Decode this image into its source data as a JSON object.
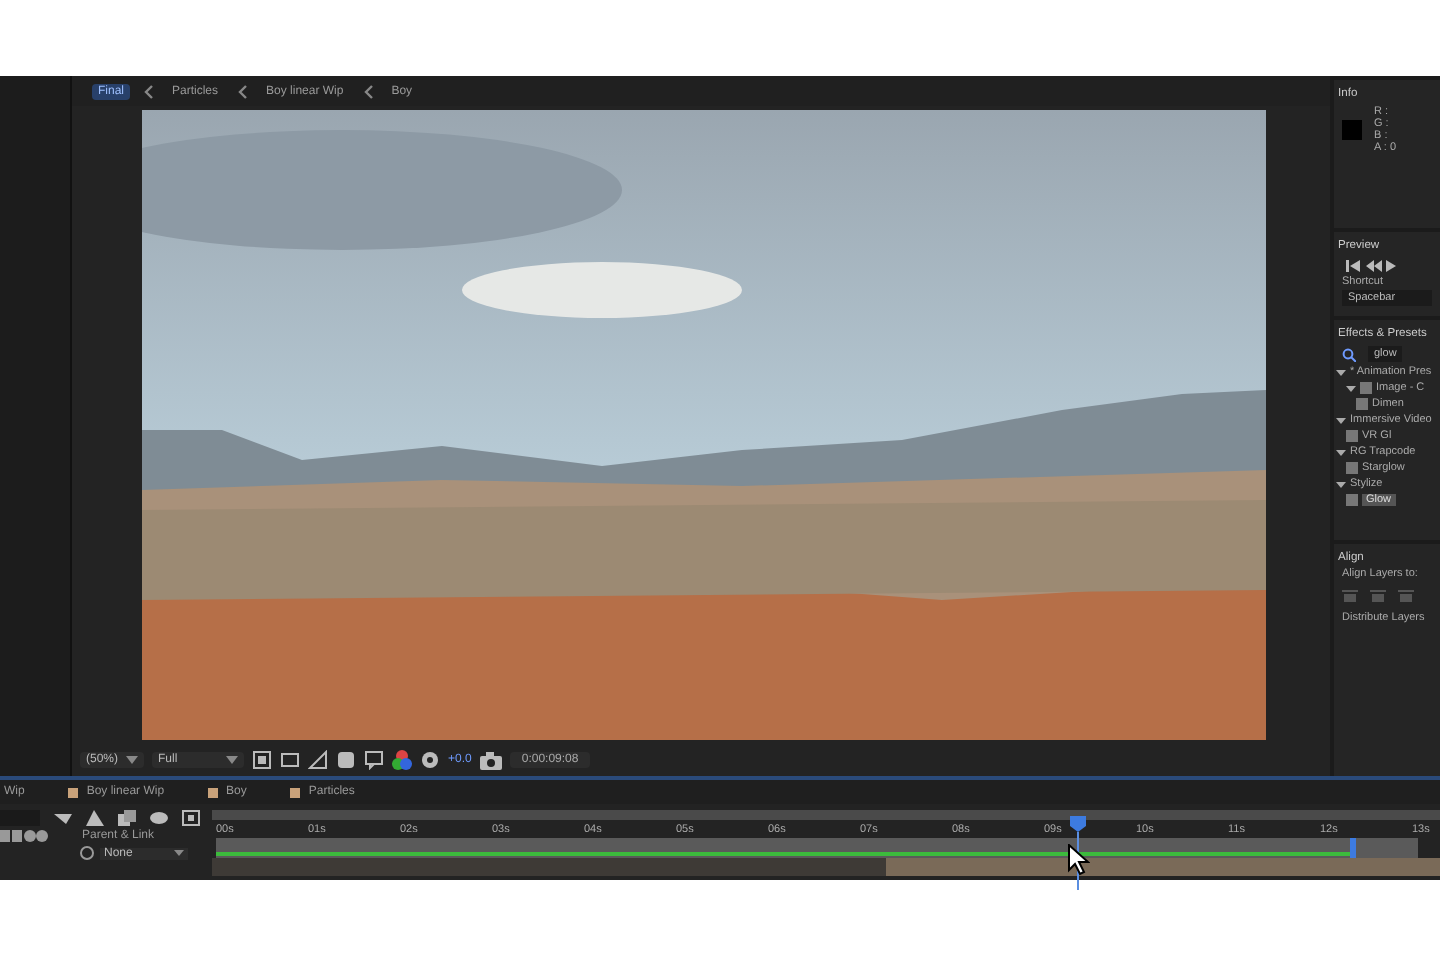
{
  "breadcrumb": [
    {
      "label": "Final",
      "selected": true
    },
    {
      "label": "Particles",
      "selected": false
    },
    {
      "label": "Boy linear Wip",
      "selected": false
    },
    {
      "label": "Boy",
      "selected": false
    }
  ],
  "viewer": {
    "zoom": "(50%)",
    "resolution": "Full",
    "exposure": "+0.0",
    "timecode": "0:00:09:08"
  },
  "info": {
    "title": "Info",
    "channels": [
      "R :",
      "G :",
      "B :",
      "A : 0"
    ]
  },
  "preview": {
    "title": "Preview",
    "shortcut_label": "Shortcut",
    "shortcut": "Spacebar"
  },
  "effects": {
    "title": "Effects & Presets",
    "search": "glow",
    "tree": [
      {
        "label": "* Animation Pres",
        "expanded": true,
        "children": [
          {
            "label": "Image - C",
            "expanded": true,
            "children": [
              {
                "label": "Dimen",
                "selected": false
              }
            ]
          }
        ]
      },
      {
        "label": "Immersive Video",
        "expanded": true,
        "children": [
          {
            "label": "VR Gl",
            "selected": false
          }
        ]
      },
      {
        "label": "RG Trapcode",
        "expanded": true,
        "children": [
          {
            "label": "Starglow",
            "selected": false
          }
        ]
      },
      {
        "label": "Stylize",
        "expanded": true,
        "children": [
          {
            "label": "Glow",
            "selected": true
          }
        ]
      }
    ]
  },
  "align": {
    "title": "Align",
    "align_to_label": "Align Layers to:",
    "distribute_label": "Distribute Layers"
  },
  "timeline": {
    "tabs": [
      {
        "label": "Wip",
        "selected": false
      },
      {
        "label": "Boy linear Wip",
        "selected": false
      },
      {
        "label": "Boy",
        "selected": false
      },
      {
        "label": "Particles",
        "selected": false
      }
    ],
    "parent_label": "Parent & Link",
    "parent_value": "None",
    "ruler": [
      "00s",
      "01s",
      "02s",
      "03s",
      "04s",
      "05s",
      "06s",
      "07s",
      "08s",
      "09s",
      "10s",
      "11s",
      "12s",
      "13s"
    ],
    "playhead": {
      "level": 0.72
    },
    "work_area": {
      "level": 0.945
    }
  }
}
